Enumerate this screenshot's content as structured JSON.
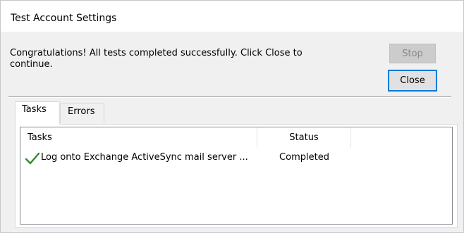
{
  "window": {
    "title": "Test Account Settings"
  },
  "message": "Congratulations! All tests completed successfully. Click Close to continue.",
  "buttons": {
    "stop_label": "Stop",
    "close_label": "Close"
  },
  "tabs": [
    {
      "label": "Tasks",
      "selected": true
    },
    {
      "label": "Errors",
      "selected": false
    }
  ],
  "table": {
    "columns": [
      "Tasks",
      "Status"
    ],
    "rows": [
      {
        "icon": "checkmark-icon",
        "task": "Log onto Exchange ActiveSync mail server ...",
        "status": "Completed"
      }
    ]
  },
  "colors": {
    "accent": "#0078d7",
    "success_check": "#2e8b2e"
  }
}
